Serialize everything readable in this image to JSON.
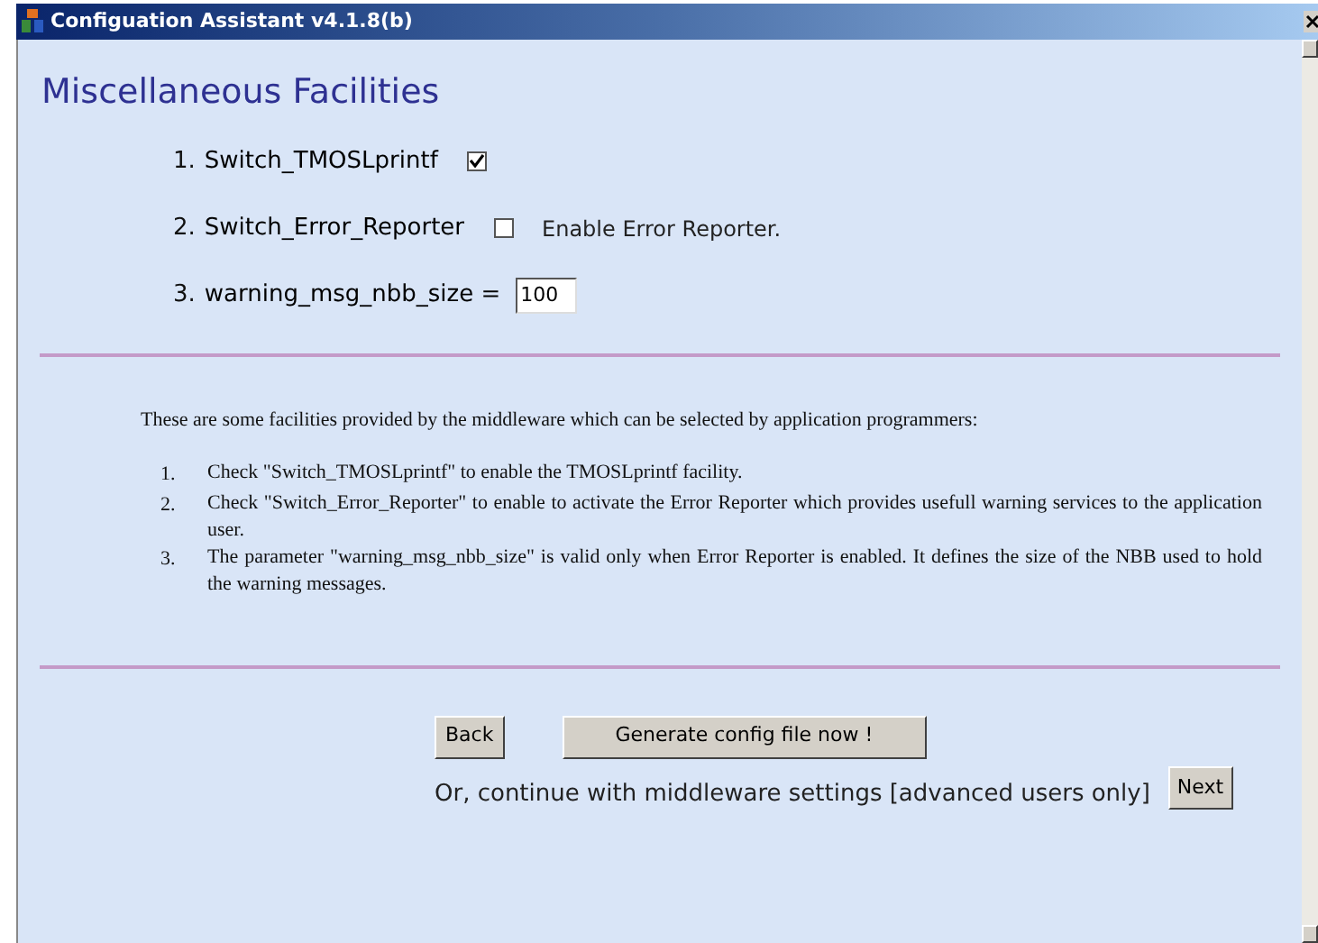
{
  "window": {
    "title": "Configuation Assistant v4.1.8(b)"
  },
  "heading": "Miscellaneous Facilities",
  "settings": [
    {
      "kind": "checkbox",
      "number": "1.",
      "label": "Switch_TMOSLprintf",
      "checked": true
    },
    {
      "kind": "checkbox",
      "number": "2.",
      "label": "Switch_Error_Reporter",
      "checked": false,
      "note": "Enable Error Reporter."
    },
    {
      "kind": "input",
      "number": "3.",
      "label": "warning_msg_nbb_size =",
      "value": "100"
    }
  ],
  "description": {
    "intro": "These are some facilities provided by the middleware which can be selected by application programmers:",
    "items": [
      {
        "number": "1.",
        "text": "Check \"Switch_TMOSLprintf\" to enable the TMOSLprintf facility."
      },
      {
        "number": "2.",
        "text": "Check \"Switch_Error_Reporter\" to enable to activate the Error Reporter which provides usefull warning services to the application user."
      },
      {
        "number": "3.",
        "text": "The parameter \"warning_msg_nbb_size\" is valid only when Error Reporter is enabled. It defines the size of the NBB used to hold the warning messages."
      }
    ]
  },
  "buttons": {
    "back": "Back",
    "generate": "Generate config file now !"
  },
  "continue": {
    "text": "Or, continue with middleware settings [advanced users only]",
    "button": "Next"
  }
}
